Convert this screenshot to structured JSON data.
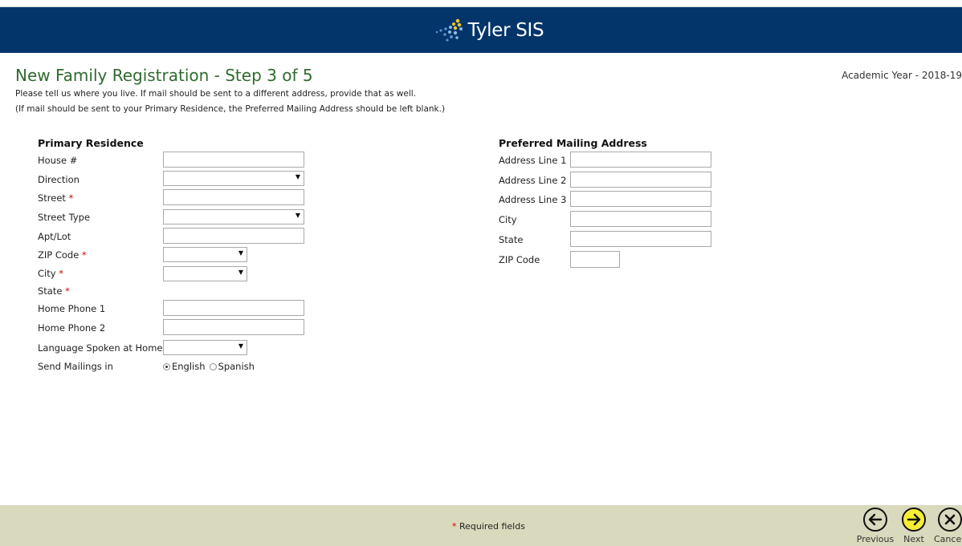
{
  "header": {
    "brand": "Tyler SIS"
  },
  "page": {
    "title": "New Family Registration - Step 3 of 5",
    "academic_year": "Academic Year - 2018-19",
    "intro_line1": "Please tell us where you live. If mail should be sent to a different address, provide that as well.",
    "intro_line2": "(If mail should be sent to your Primary Residence, the Preferred Mailing Address should be left blank.)"
  },
  "primary": {
    "heading": "Primary Residence",
    "house_label": "House #",
    "direction_label": "Direction",
    "street_label": "Street",
    "street_type_label": "Street Type",
    "apt_label": "Apt/Lot",
    "zip_label": "ZIP Code",
    "city_label": "City",
    "state_label": "State",
    "phone1_label": "Home Phone 1",
    "phone2_label": "Home Phone 2",
    "language_label": "Language Spoken at Home",
    "mailings_label": "Send Mailings in",
    "mailings_options": [
      "English",
      "Spanish"
    ],
    "mailings_selected": "English",
    "required_mark": "*",
    "values": {
      "house": "",
      "direction": "",
      "street": "",
      "street_type": "",
      "apt": "",
      "zip": "",
      "city": "",
      "phone1": "",
      "phone2": "",
      "language": ""
    }
  },
  "mailing": {
    "heading": "Preferred Mailing Address",
    "addr1_label": "Address Line 1",
    "addr2_label": "Address Line 2",
    "addr3_label": "Address Line 3",
    "city_label": "City",
    "state_label": "State",
    "zip_label": "ZIP Code",
    "values": {
      "addr1": "",
      "addr2": "",
      "addr3": "",
      "city": "",
      "state": "",
      "zip": ""
    }
  },
  "footer": {
    "required_mark": "*",
    "required_text": "Required fields",
    "previous_label": "Previous",
    "next_label": "Next",
    "cancel_label": "Cance"
  },
  "icons": {
    "logo": "tyler-dots-logo",
    "previous": "left-arrow-circle-icon",
    "next": "right-arrow-circle-icon",
    "cancel": "x-circle-icon"
  },
  "colors": {
    "banner": "#03356b",
    "title": "#2f6b2f",
    "required": "#d10000",
    "footer": "#d9d9bd",
    "next_button": "#f5ee35"
  }
}
